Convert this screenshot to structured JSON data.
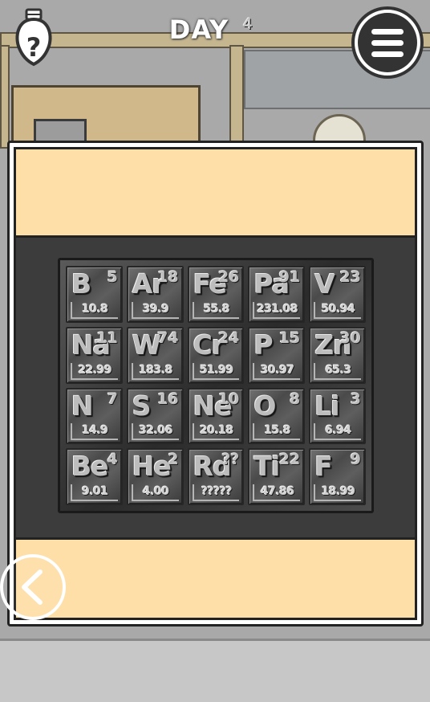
{
  "hud": {
    "day_number": "4",
    "day_label": "DAY",
    "hint_icon": "lightbulb-question-icon",
    "menu_icon": "hamburger-menu-icon"
  },
  "colors": {
    "panel_fill": "#fedfa8",
    "dark_band": "#3c3c3c",
    "metal": "#5e5e5e"
  },
  "periodic_table": {
    "tiles": [
      {
        "symbol": "B",
        "number": "5",
        "mass": "10.8"
      },
      {
        "symbol": "Ar",
        "number": "18",
        "mass": "39.9"
      },
      {
        "symbol": "Fe",
        "number": "26",
        "mass": "55.8"
      },
      {
        "symbol": "Pa",
        "number": "91",
        "mass": "231.08"
      },
      {
        "symbol": "V",
        "number": "23",
        "mass": "50.94"
      },
      {
        "symbol": "Na",
        "number": "11",
        "mass": "22.99"
      },
      {
        "symbol": "W",
        "number": "74",
        "mass": "183.8"
      },
      {
        "symbol": "Cr",
        "number": "24",
        "mass": "51.99"
      },
      {
        "symbol": "P",
        "number": "15",
        "mass": "30.97"
      },
      {
        "symbol": "Zn",
        "number": "30",
        "mass": "65.3"
      },
      {
        "symbol": "N",
        "number": "7",
        "mass": "14.9"
      },
      {
        "symbol": "S",
        "number": "16",
        "mass": "32.06"
      },
      {
        "symbol": "Ne",
        "number": "10",
        "mass": "20.18"
      },
      {
        "symbol": "O",
        "number": "8",
        "mass": "15.8"
      },
      {
        "symbol": "Li",
        "number": "3",
        "mass": "6.94"
      },
      {
        "symbol": "Be",
        "number": "4",
        "mass": "9.01"
      },
      {
        "symbol": "He",
        "number": "2",
        "mass": "4.00"
      },
      {
        "symbol": "Rd",
        "number": "??",
        "mass": "?????"
      },
      {
        "symbol": "Ti",
        "number": "22",
        "mass": "47.86"
      },
      {
        "symbol": "F",
        "number": "9",
        "mass": "18.99"
      }
    ]
  },
  "navigation": {
    "back_icon": "chevron-left-icon"
  }
}
